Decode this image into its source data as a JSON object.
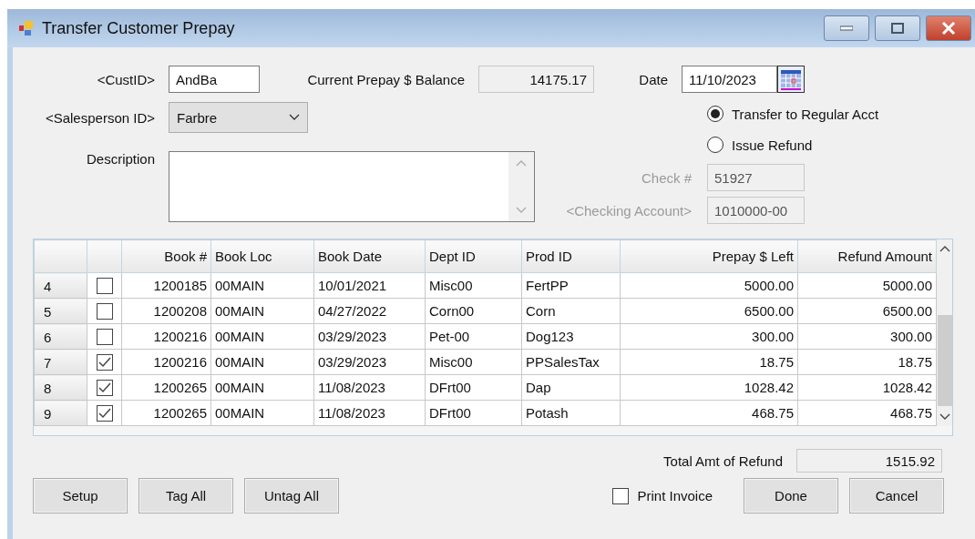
{
  "window": {
    "title": "Transfer Customer Prepay"
  },
  "cust_id": {
    "label": "<CustID>",
    "value": "AndBa"
  },
  "current_balance": {
    "label": "Current Prepay $ Balance",
    "value": "14175.17"
  },
  "date": {
    "label": "Date",
    "value": "11/10/2023"
  },
  "salesperson": {
    "label": "<Salesperson ID>",
    "value": "Farbre"
  },
  "description": {
    "label": "Description"
  },
  "refund_mode": [
    {
      "label": "Transfer to Regular Acct",
      "selected": true
    },
    {
      "label": "Issue Refund",
      "selected": false
    }
  ],
  "check_number": {
    "label": "Check #",
    "value": "51927",
    "disabled": true
  },
  "checking_account": {
    "label": "<Checking Account>",
    "value": "1010000-00",
    "disabled": true
  },
  "table": {
    "columns": [
      "Book #",
      "Book Loc",
      "Book Date",
      "Dept ID",
      "Prod ID",
      "Prepay $ Left",
      "Refund Amount"
    ],
    "rows": [
      {
        "row_number": "4",
        "tagged": false,
        "cells": [
          "1200185",
          "00MAIN",
          "10/01/2021",
          "Misc00",
          "FertPP",
          "5000.00",
          "5000.00"
        ]
      },
      {
        "row_number": "5",
        "tagged": false,
        "cells": [
          "1200208",
          "00MAIN",
          "04/27/2022",
          "Corn00",
          "Corn",
          "6500.00",
          "6500.00"
        ]
      },
      {
        "row_number": "6",
        "tagged": false,
        "cells": [
          "1200216",
          "00MAIN",
          "03/29/2023",
          "Pet-00",
          "Dog123",
          "300.00",
          "300.00"
        ]
      },
      {
        "row_number": "7",
        "tagged": true,
        "cells": [
          "1200216",
          "00MAIN",
          "03/29/2023",
          "Misc00",
          "PPSalesTax",
          "18.75",
          "18.75"
        ]
      },
      {
        "row_number": "8",
        "tagged": true,
        "cells": [
          "1200265",
          "00MAIN",
          "11/08/2023",
          "DFrt00",
          "Dap",
          "1028.42",
          "1028.42"
        ]
      },
      {
        "row_number": "9",
        "tagged": true,
        "cells": [
          "1200265",
          "00MAIN",
          "11/08/2023",
          "DFrt00",
          "Potash",
          "468.75",
          "468.75"
        ]
      }
    ]
  },
  "total_refund": {
    "label": "Total Amt of Refund",
    "value": "1515.92"
  },
  "print_invoice": {
    "label": "Print Invoice",
    "checked": false
  },
  "left_buttons": [
    "Setup",
    "Tag All",
    "Untag All"
  ],
  "right_buttons": [
    "Done",
    "Cancel"
  ]
}
